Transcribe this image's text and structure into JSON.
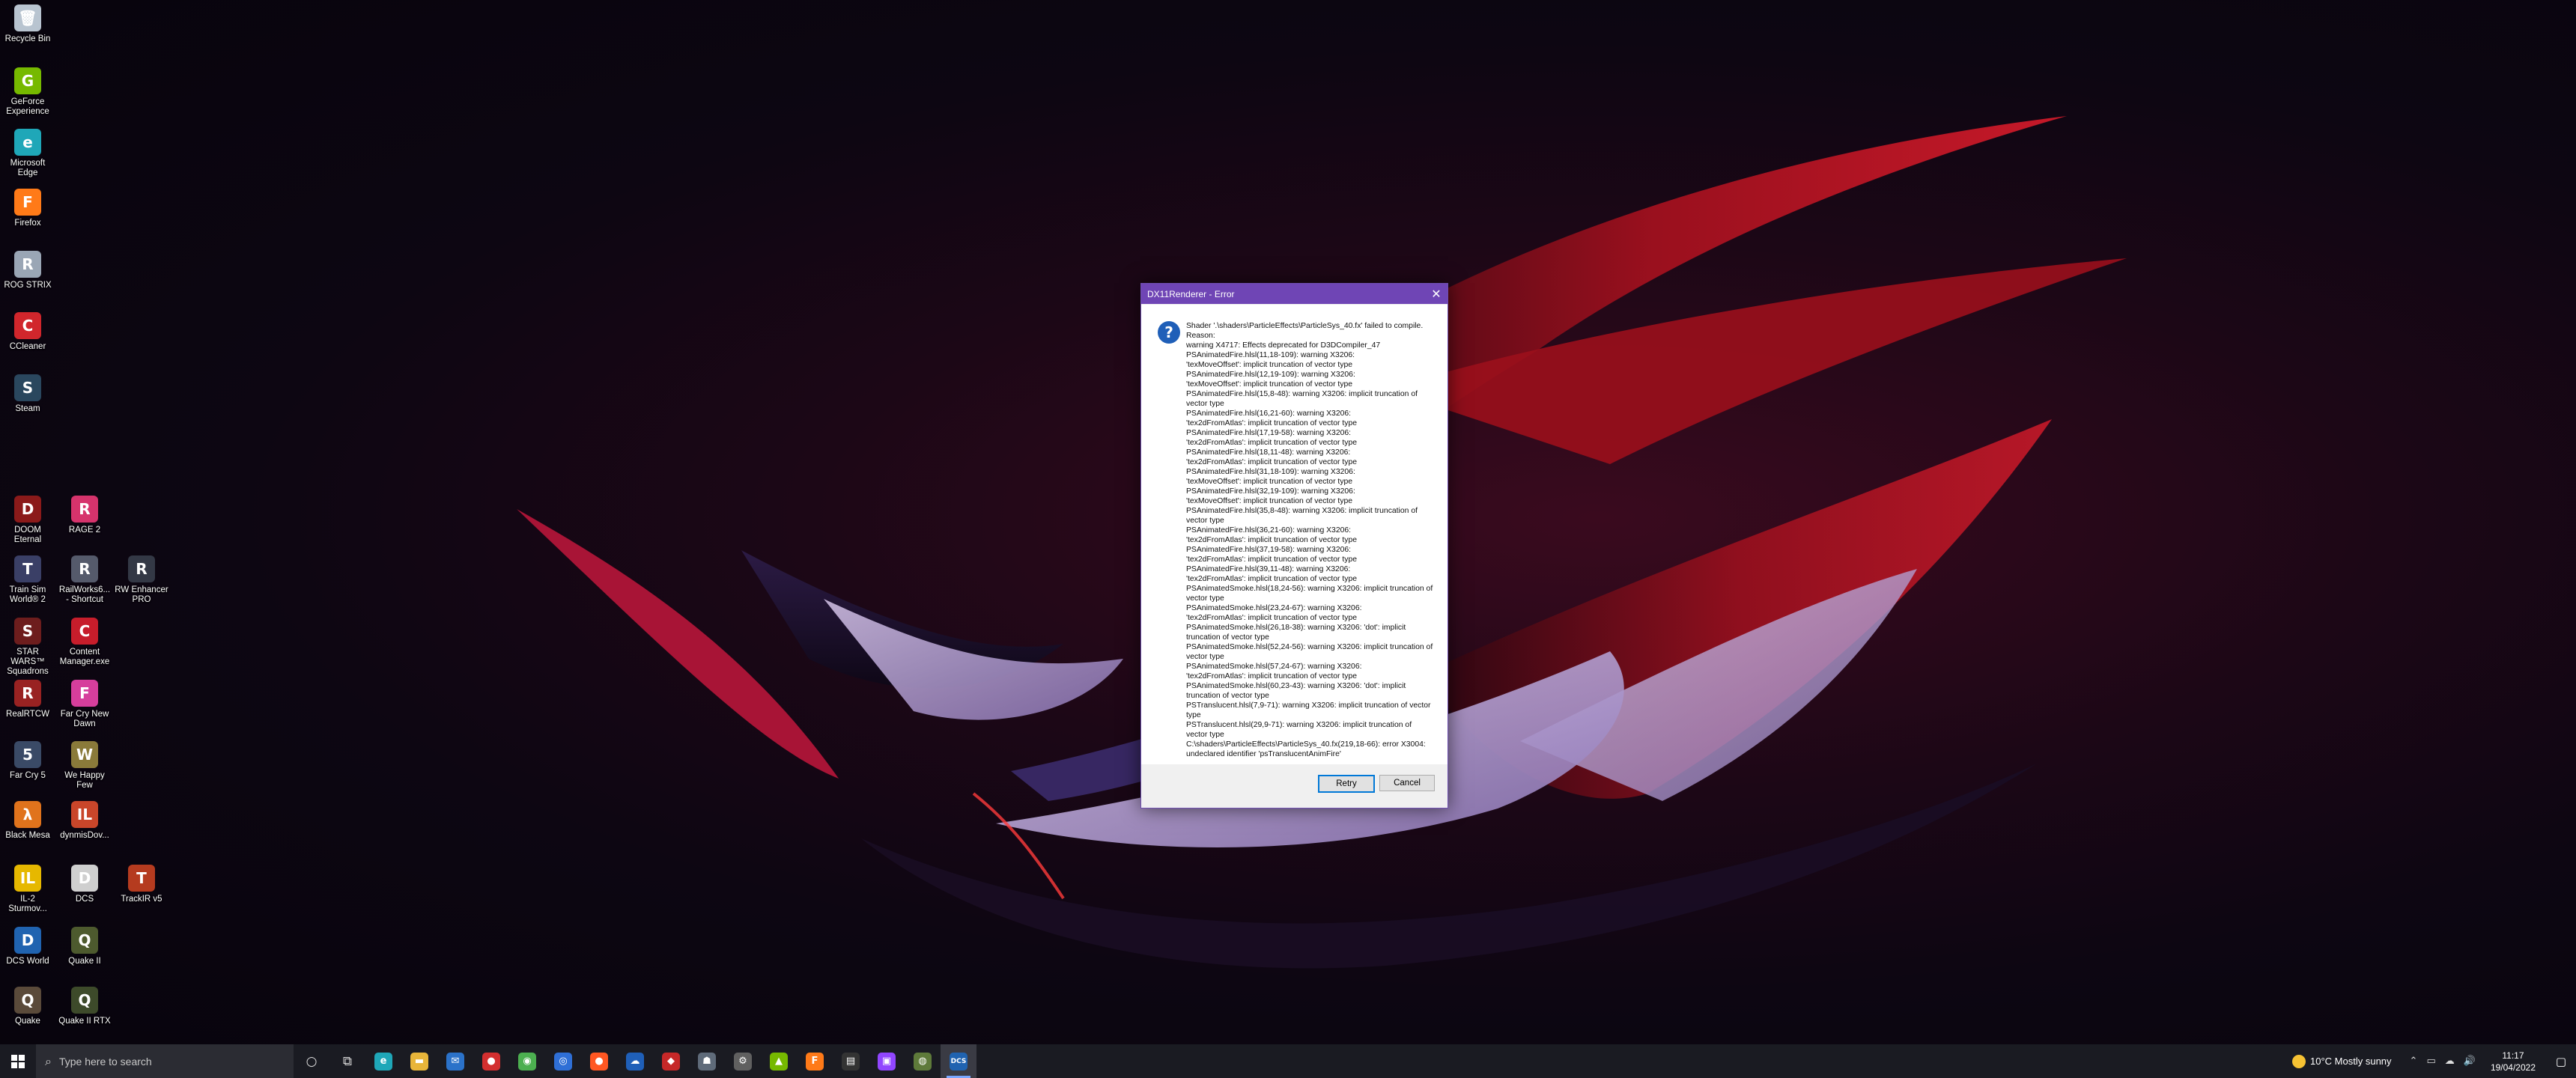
{
  "desktop": {
    "icons": [
      {
        "label": "Recycle Bin",
        "glyph": "🗑",
        "color": "#b8c4d0",
        "icon": "recycle-bin-icon"
      },
      {
        "label": "GeForce\nExperience",
        "glyph": "G",
        "color": "#76b900",
        "icon": "geforce-icon"
      },
      {
        "label": "Microsoft\nEdge",
        "glyph": "e",
        "color": "#1fa7b8",
        "icon": "edge-icon"
      },
      {
        "label": "Firefox",
        "glyph": "F",
        "color": "#ff7a18",
        "icon": "firefox-icon"
      },
      {
        "label": "ROG STRIX",
        "glyph": "R",
        "color": "#9aa6b5",
        "icon": "rog-strix-icon"
      },
      {
        "label": "CCleaner",
        "glyph": "C",
        "color": "#d1262c",
        "icon": "ccleaner-icon"
      },
      {
        "label": "Steam",
        "glyph": "S",
        "color": "#2a475e",
        "icon": "steam-icon"
      },
      {
        "label": "DOOM\nEternal",
        "glyph": "D",
        "color": "#8b1a1a",
        "icon": "doom-icon"
      },
      {
        "label": "RAGE 2",
        "glyph": "R",
        "color": "#d6336c",
        "icon": "rage2-icon"
      },
      {
        "label": "Train Sim\nWorld® 2",
        "glyph": "T",
        "color": "#3a3f66",
        "icon": "train-sim-icon"
      },
      {
        "label": "RailWorks6...\n- Shortcut",
        "glyph": "R",
        "color": "#555a6b",
        "icon": "railworks-icon"
      },
      {
        "label": "RW Enhancer\nPRO",
        "glyph": "R",
        "color": "#333845",
        "icon": "rw-enhancer-icon"
      },
      {
        "label": "STAR WARS™\nSquadrons",
        "glyph": "S",
        "color": "#6d1d1d",
        "icon": "star-wars-icon"
      },
      {
        "label": "Content\nManager.exe",
        "glyph": "C",
        "color": "#c71d2b",
        "icon": "content-manager-icon"
      },
      {
        "label": "RealRTCW",
        "glyph": "R",
        "color": "#992222",
        "icon": "realrtcw-icon"
      },
      {
        "label": "Far Cry New\nDawn",
        "glyph": "F",
        "color": "#d63e9c",
        "icon": "far-cry-new-dawn-icon"
      },
      {
        "label": "Far Cry 5",
        "glyph": "5",
        "color": "#3a4a66",
        "icon": "far-cry-5-icon"
      },
      {
        "label": "We Happy\nFew",
        "glyph": "W",
        "color": "#8a7a3a",
        "icon": "we-happy-few-icon"
      },
      {
        "label": "Black Mesa",
        "glyph": "λ",
        "color": "#e0731c",
        "icon": "black-mesa-icon"
      },
      {
        "label": "dynmisDov...",
        "glyph": "IL",
        "color": "#c9462a",
        "icon": "il2-dynamis-icon"
      },
      {
        "label": "IL-2\nSturmov...",
        "glyph": "IL",
        "color": "#e6b800",
        "icon": "il2-icon"
      },
      {
        "label": "DCS",
        "glyph": "D",
        "color": "#cfcfcf",
        "icon": "dcs-file-icon"
      },
      {
        "label": "TrackIR v5",
        "glyph": "T",
        "color": "#b53b1f",
        "icon": "trackir-icon"
      },
      {
        "label": "DCS World",
        "glyph": "D",
        "color": "#2063b0",
        "icon": "dcs-world-icon"
      },
      {
        "label": "Quake II",
        "glyph": "Q",
        "color": "#4d5a2e",
        "icon": "quake2-icon"
      },
      {
        "label": "Quake",
        "glyph": "Q",
        "color": "#5a4a3a",
        "icon": "quake-icon"
      },
      {
        "label": "Quake II RTX",
        "glyph": "Q",
        "color": "#3d4a2a",
        "icon": "quake2-rtx-icon"
      }
    ]
  },
  "dialog": {
    "title": "DX11Renderer - Error",
    "close_glyph": "✕",
    "question_glyph": "?",
    "message": "Shader '.\\shaders\\ParticleEffects\\ParticleSys_40.fx' failed to compile. Reason:\nwarning X4717: Effects deprecated for D3DCompiler_47\nPSAnimatedFire.hlsl(11,18-109): warning X3206:\n'texMoveOffset': implicit truncation of vector type\nPSAnimatedFire.hlsl(12,19-109): warning X3206:\n'texMoveOffset': implicit truncation of vector type\nPSAnimatedFire.hlsl(15,8-48): warning X3206: implicit truncation of vector type\nPSAnimatedFire.hlsl(16,21-60): warning X3206:\n'tex2dFromAtlas': implicit truncation of vector type\nPSAnimatedFire.hlsl(17,19-58): warning X3206:\n'tex2dFromAtlas': implicit truncation of vector type\nPSAnimatedFire.hlsl(18,11-48): warning X3206:\n'tex2dFromAtlas': implicit truncation of vector type\nPSAnimatedFire.hlsl(31,18-109): warning X3206:\n'texMoveOffset': implicit truncation of vector type\nPSAnimatedFire.hlsl(32,19-109): warning X3206:\n'texMoveOffset': implicit truncation of vector type\nPSAnimatedFire.hlsl(35,8-48): warning X3206: implicit truncation of vector type\nPSAnimatedFire.hlsl(36,21-60): warning X3206:\n'tex2dFromAtlas': implicit truncation of vector type\nPSAnimatedFire.hlsl(37,19-58): warning X3206:\n'tex2dFromAtlas': implicit truncation of vector type\nPSAnimatedFire.hlsl(39,11-48): warning X3206:\n'tex2dFromAtlas': implicit truncation of vector type\nPSAnimatedSmoke.hlsl(18,24-56): warning X3206: implicit truncation of vector type\nPSAnimatedSmoke.hlsl(23,24-67): warning X3206:\n'tex2dFromAtlas': implicit truncation of vector type\nPSAnimatedSmoke.hlsl(26,18-38): warning X3206: 'dot': implicit truncation of vector type\nPSAnimatedSmoke.hlsl(52,24-56): warning X3206: implicit truncation of vector type\nPSAnimatedSmoke.hlsl(57,24-67): warning X3206:\n'tex2dFromAtlas': implicit truncation of vector type\nPSAnimatedSmoke.hlsl(60,23-43): warning X3206: 'dot': implicit truncation of vector type\nPSTranslucent.hlsl(7,9-71): warning X3206: implicit truncation of vector type\nPSTranslucent.hlsl(29,9-71): warning X3206: implicit truncation of vector type\nC:\\shaders\\ParticleEffects\\ParticleSys_40.fx(219,18-66): error X3004: undeclared identifier 'psTranslucentAnimFire'",
    "retry_label": "Retry",
    "cancel_label": "Cancel"
  },
  "taskbar": {
    "search_placeholder": "Type here to search",
    "search_glyph": "⌕",
    "cortana_glyph": "○",
    "taskview_glyph": "⧉",
    "apps": [
      {
        "glyph": "e",
        "color": "#1fa7b8",
        "icon": "edge-taskbar-icon"
      },
      {
        "glyph": "▬",
        "color": "#e8b53a",
        "icon": "file-explorer-icon"
      },
      {
        "glyph": "✉",
        "color": "#2b72c9",
        "icon": "mail-icon"
      },
      {
        "glyph": "●",
        "color": "#d32f2f",
        "icon": "rog-armoury-icon"
      },
      {
        "glyph": "◉",
        "color": "#4caf50",
        "icon": "chrome-icon"
      },
      {
        "glyph": "◎",
        "color": "#2f6fd6",
        "icon": "app-circle-icon"
      },
      {
        "glyph": "●",
        "color": "#ff5722",
        "icon": "origin-icon"
      },
      {
        "glyph": "☁",
        "color": "#1f5fb8",
        "icon": "onedrive-icon"
      },
      {
        "glyph": "◆",
        "color": "#c62828",
        "icon": "game-launcher-icon"
      },
      {
        "glyph": "☗",
        "color": "#5f6b7a",
        "icon": "steam-taskbar-icon"
      },
      {
        "glyph": "⚙",
        "color": "#606060",
        "icon": "settings-icon"
      },
      {
        "glyph": "▲",
        "color": "#76b900",
        "icon": "nvidia-icon"
      },
      {
        "glyph": "F",
        "color": "#ff7a18",
        "icon": "firefox-taskbar-icon"
      },
      {
        "glyph": "▤",
        "color": "#333",
        "icon": "terminal-icon"
      },
      {
        "glyph": "▣",
        "color": "#9146ff",
        "icon": "twitch-icon"
      },
      {
        "glyph": "◍",
        "color": "#5e7a3a",
        "icon": "xbox-icon"
      },
      {
        "glyph": "DCS",
        "color": "#2063b0",
        "icon": "dcs-taskbar-icon",
        "active": true
      }
    ],
    "weather_text": "10°C  Mostly sunny",
    "chevron_glyph": "⌃",
    "tray_icons": [
      "▭",
      "☁",
      "🔊"
    ],
    "time": "11:17",
    "date": "19/04/2022",
    "notification_glyph": "▢"
  },
  "colors": {
    "dialog_title_bar": "#6f45b5",
    "taskbar": "#1a1b22",
    "accent": "#0078d7"
  }
}
